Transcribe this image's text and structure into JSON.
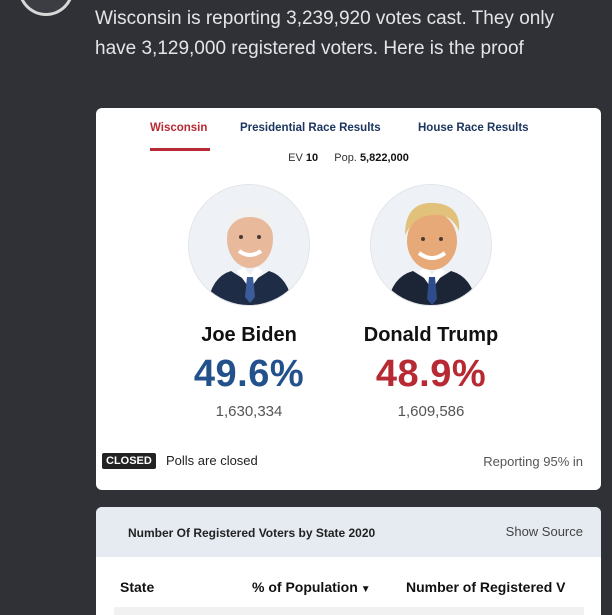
{
  "tweet": {
    "text": "Wisconsin is reporting 3,239,920 votes cast. They only have 3,129,000 registered voters. Here is the proof"
  },
  "tabs": [
    {
      "label": "Wisconsin"
    },
    {
      "label": "Presidential Race Results"
    },
    {
      "label": "House Race Results"
    }
  ],
  "state_info": {
    "ev_label": "EV",
    "ev_value": "10",
    "pop_label": "Pop.",
    "pop_value": "5,822,000"
  },
  "candidates": [
    {
      "name": "Joe Biden",
      "percent": "49.6%",
      "votes": "1,630,334",
      "color": "#23518c"
    },
    {
      "name": "Donald Trump",
      "percent": "48.9%",
      "votes": "1,609,586",
      "color": "#b72a34"
    }
  ],
  "status": {
    "badge": "CLOSED",
    "text": "Polls are closed",
    "reporting": "Reporting 95% in"
  },
  "registered_table": {
    "title": "Number Of Registered Voters by State 2020",
    "show_source": "Show Source",
    "columns": [
      "State",
      "% of Population",
      "Number of Registered V"
    ]
  },
  "icons": {
    "sort": "sort-down-icon"
  }
}
